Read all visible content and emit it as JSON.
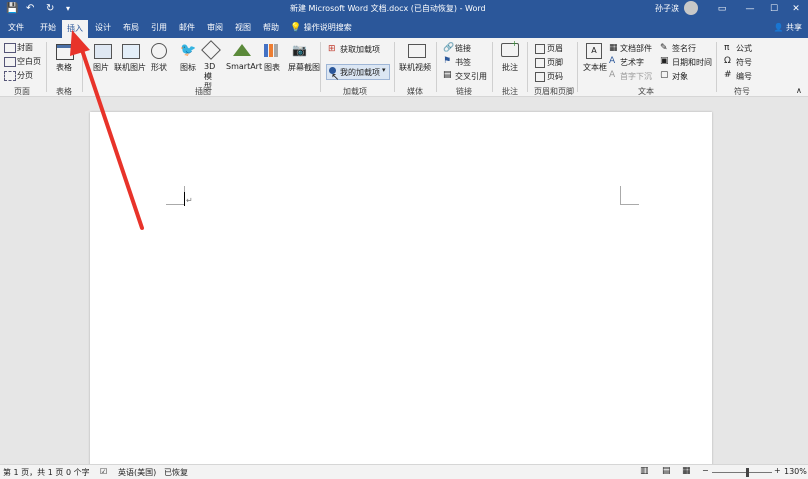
{
  "window": {
    "title": "新建 Microsoft Word 文档.docx (已自动恢复) - Word",
    "user": "孙子涙"
  },
  "tabs": [
    "文件",
    "开始",
    "插入",
    "设计",
    "布局",
    "引用",
    "邮件",
    "审阅",
    "视图",
    "帮助"
  ],
  "active_tab": "插入",
  "search": "操作说明搜索",
  "share": "共享",
  "ribbon": {
    "pages": {
      "cover": "封面",
      "blank": "空白页",
      "break": "分页",
      "group": "页面"
    },
    "tables": {
      "table": "表格",
      "group": "表格"
    },
    "illustrations": {
      "picture": "图片",
      "online_picture": "联机图片",
      "shapes": "形状",
      "icons": "图标",
      "model_3d": "3D 模型",
      "smartart": "SmartArt",
      "chart": "图表",
      "screenshot": "屏幕截图",
      "group": "插图"
    },
    "addins": {
      "get": "获取加载项",
      "my": "我的加载项",
      "group": "加载项"
    },
    "media": {
      "online_video": "联机视频",
      "group": "媒体"
    },
    "links": {
      "link": "链接",
      "bookmark": "书签",
      "cross_ref": "交叉引用",
      "group": "链接"
    },
    "comments": {
      "comment": "批注",
      "group": "批注"
    },
    "header_footer": {
      "header": "页眉",
      "footer": "页脚",
      "page_number": "页码",
      "group": "页眉和页脚"
    },
    "text": {
      "textbox": "文本框",
      "doc_parts": "文档部件",
      "wordart": "艺术字",
      "drop_cap": "首字下沉",
      "signature": "签名行",
      "date_time": "日期和时间",
      "object": "对象",
      "group": "文本"
    },
    "symbols": {
      "equation": "公式",
      "symbol": "符号",
      "number": "编号",
      "group": "符号"
    }
  },
  "status": {
    "page": "第 1 页，共 1 页",
    "words": "0 个字",
    "language": "英语(美国)",
    "recovered": "已恢复",
    "zoom": "130%"
  },
  "zoom_level": 1.3,
  "colors": {
    "accent": "#2b579a",
    "annotation": "#e8332a"
  }
}
